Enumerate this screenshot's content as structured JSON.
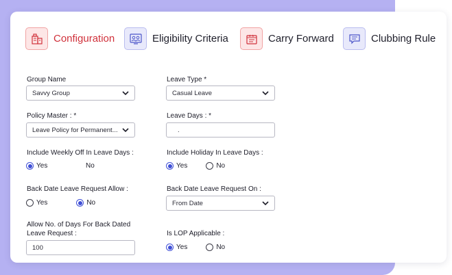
{
  "tabs": [
    {
      "label": "Configuration",
      "icon": "building-icon",
      "active": true
    },
    {
      "label": "Eligibility Criteria",
      "icon": "group-icon",
      "active": false
    },
    {
      "label": "Carry Forward",
      "icon": "calendar-stars-icon",
      "active": false
    },
    {
      "label": "Clubbing Rule",
      "icon": "chat-list-icon",
      "active": false
    }
  ],
  "form": {
    "group_name": {
      "label": "Group Name",
      "value": "Savvy Group"
    },
    "leave_type": {
      "label": "Leave Type *",
      "value": "Casual Leave"
    },
    "policy_master": {
      "label": "Policy Master : *",
      "value": "Leave Policy for Permanent..."
    },
    "leave_days": {
      "label": "Leave Days : *",
      "value": "."
    },
    "include_weekly_off": {
      "label": "Include Weekly Off In Leave Days :",
      "yes": "Yes",
      "no": "No",
      "selected": "yes"
    },
    "include_holiday": {
      "label": "Include Holiday In Leave Days :",
      "yes": "Yes",
      "no": "No",
      "selected": "yes"
    },
    "back_date_allow": {
      "label": "Back Date Leave Request Allow :",
      "yes": "Yes",
      "no": "No",
      "selected": "no"
    },
    "back_date_on": {
      "label": "Back Date Leave Request On :",
      "value": "From Date"
    },
    "allow_days": {
      "label_line1": "Allow No. of Days For Back Dated",
      "label_line2": "Leave Request :",
      "value": "100"
    },
    "is_lop": {
      "label": "Is LOP Applicable :",
      "yes": "Yes",
      "no": "No",
      "selected": "yes"
    }
  },
  "colors": {
    "accent_red": "#d0303a",
    "radio_blue": "#3f4fd6",
    "background_purple": "#b5b1f2"
  }
}
